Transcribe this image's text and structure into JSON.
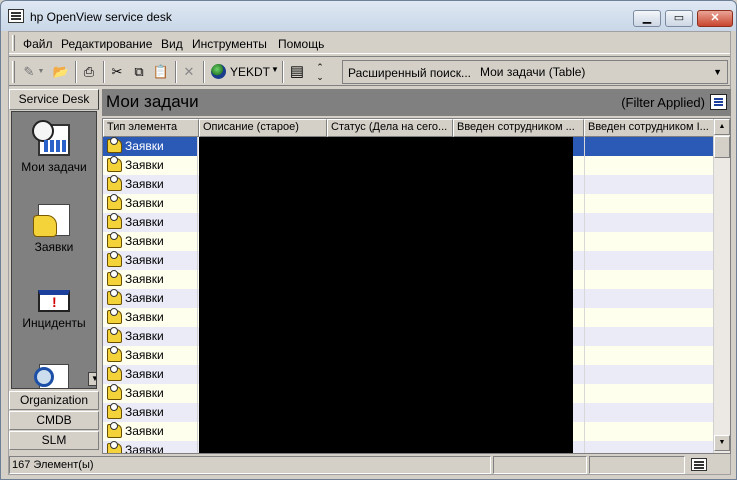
{
  "window": {
    "title": "hp OpenView service desk"
  },
  "menu": [
    "Файл",
    "Редактирование",
    "Вид",
    "Инструменты",
    "Помощь"
  ],
  "toolbar": {
    "timezone": "YEKDT",
    "search_prefix": "Расширенный поиск...",
    "search_value": "Мои задачи (Table)"
  },
  "sidebar": {
    "header": "Service Desk",
    "items": [
      {
        "label": "Мои задачи",
        "icon": "tasks-icon"
      },
      {
        "label": "Заявки",
        "icon": "requests-icon"
      },
      {
        "label": "Инциденты",
        "icon": "incidents-icon"
      },
      {
        "label": "",
        "icon": "search-icon"
      }
    ],
    "tabs": [
      "Organization",
      "CMDB",
      "SLM"
    ]
  },
  "main": {
    "title": "Мои задачи",
    "filter": "(Filter Applied)",
    "columns": [
      "Тип элемента",
      "Описание (старое)",
      "Статус (Дела на сего...",
      "Введен сотрудником ...",
      "Введен сотрудником І..."
    ],
    "rows": [
      "Заявки",
      "Заявки",
      "Заявки",
      "Заявки",
      "Заявки",
      "Заявки",
      "Заявки",
      "Заявки",
      "Заявки",
      "Заявки",
      "Заявки",
      "Заявки",
      "Заявки",
      "Заявки",
      "Заявки",
      "Заявки",
      "Заявки"
    ]
  },
  "status": {
    "count": "167 Элемент(ы)"
  }
}
